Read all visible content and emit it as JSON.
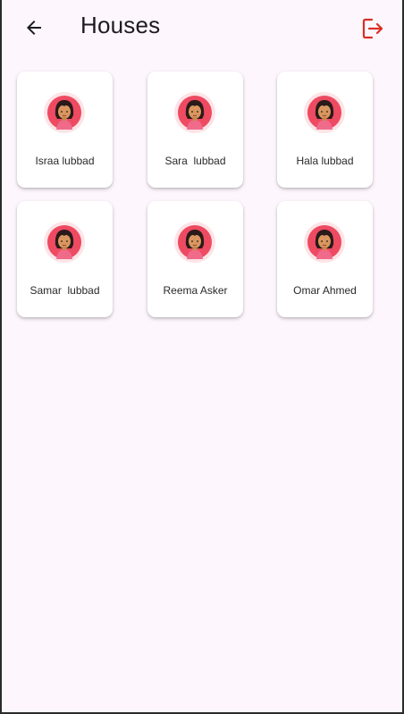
{
  "header": {
    "title": "Houses",
    "back_icon": "arrow-left-icon",
    "logout_icon": "logout-icon",
    "logout_color": "#d93025"
  },
  "houses": [
    {
      "name": "Israa lubbad"
    },
    {
      "name": "Sara  lubbad"
    },
    {
      "name": "Hala lubbad"
    },
    {
      "name": "Samar  lubbad"
    },
    {
      "name": "Reema Asker"
    },
    {
      "name": "Omar Ahmed"
    }
  ],
  "colors": {
    "background": "#fdf6fd",
    "card": "#ffffff",
    "avatar_ring": "#fde4e6",
    "avatar_bg": "#ee4a62"
  }
}
